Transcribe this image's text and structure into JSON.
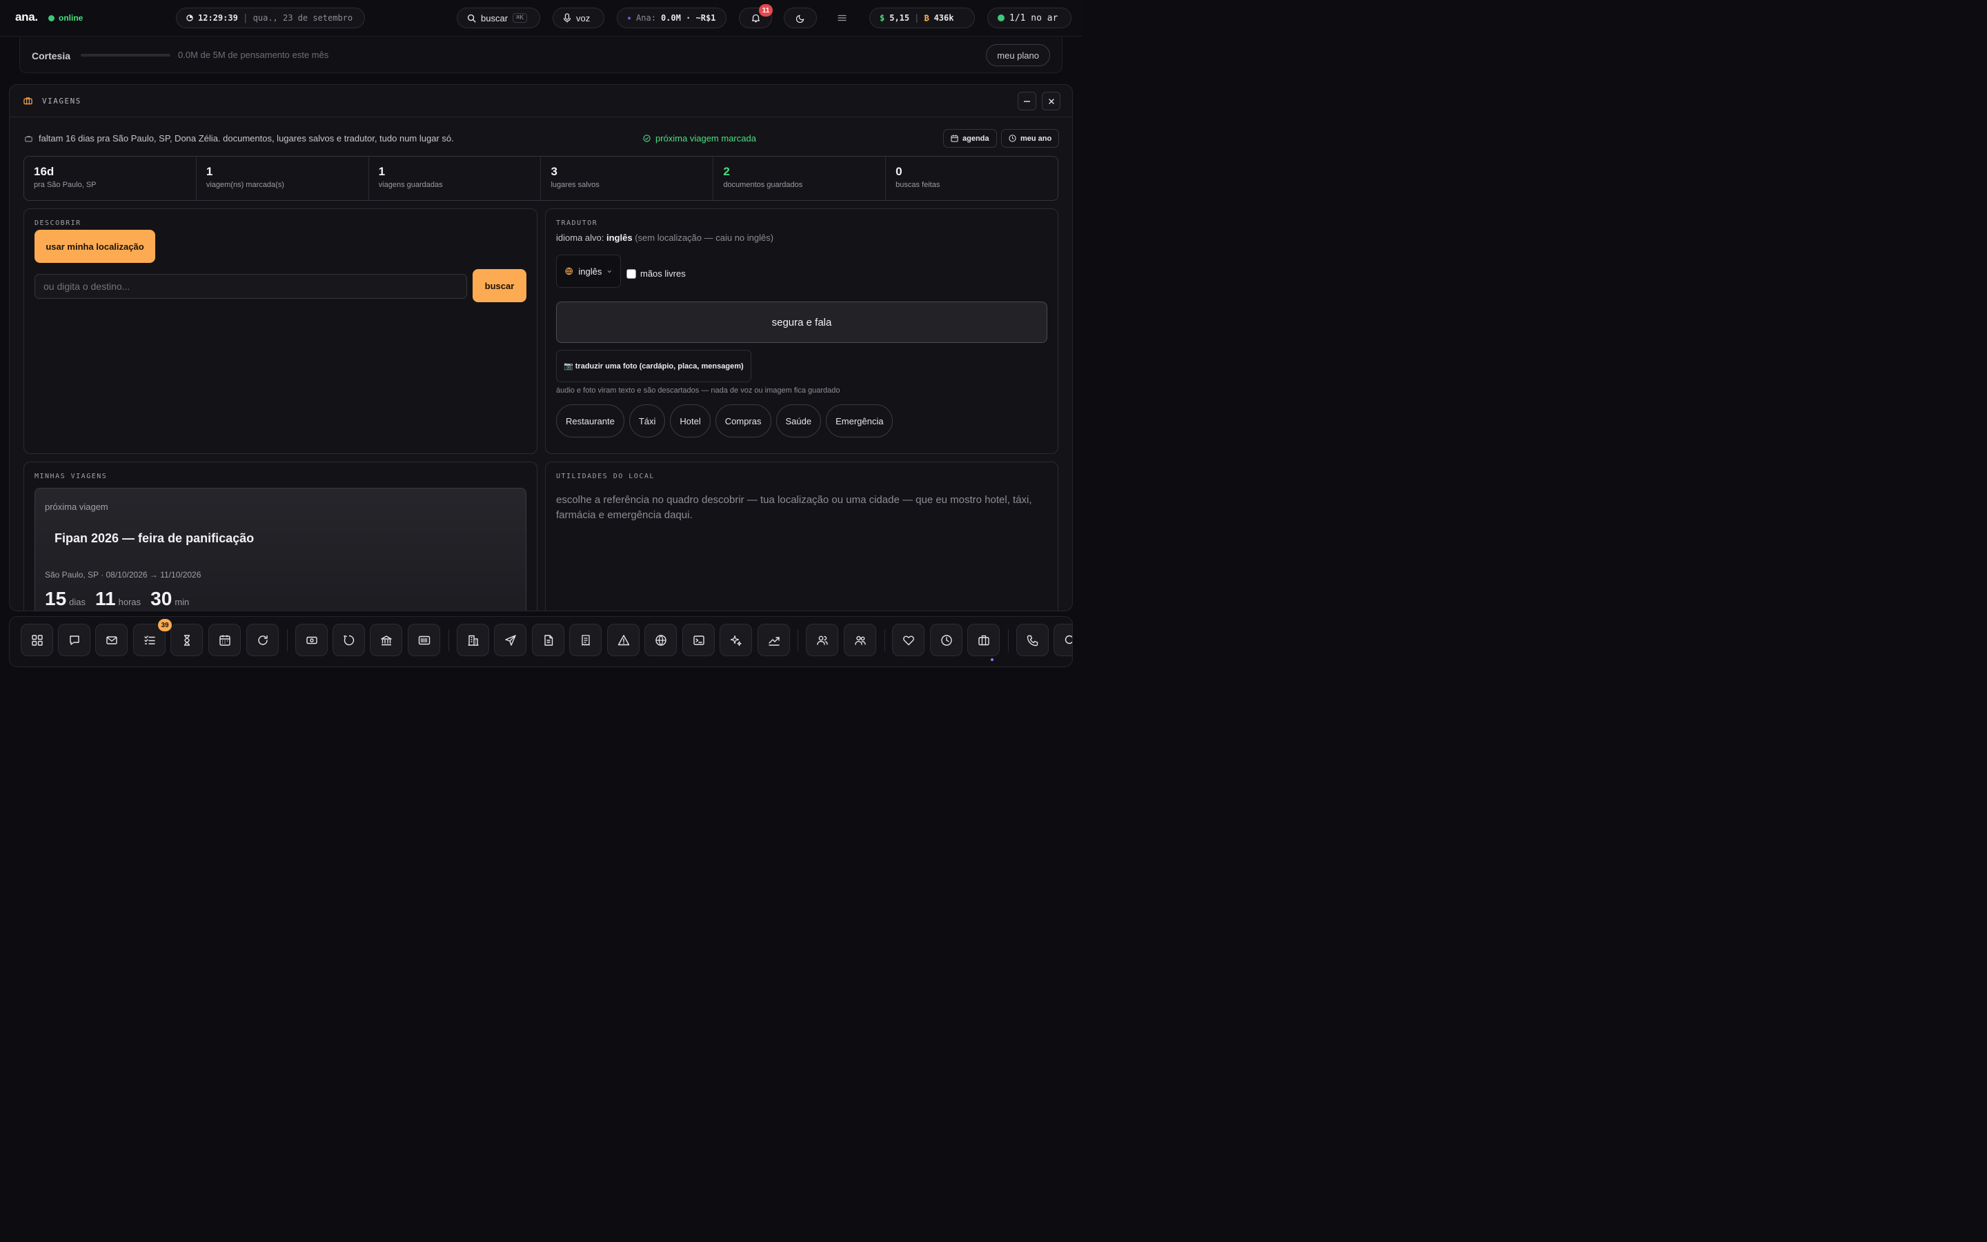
{
  "topbar": {
    "logo": "ana.",
    "status": "online",
    "time": "12:29:39",
    "date": "qua., 23 de setembro",
    "search_label": "buscar",
    "search_kbd": "⌘K",
    "voice_label": "voz",
    "ana_label": "Ana:",
    "ana_usage": "0.0M · ~R$1",
    "notifications_count": "11",
    "dollar_value": "5,15",
    "bitcoin_value": "436k",
    "on_air": "1/1 no ar"
  },
  "plan": {
    "name": "Cortesia",
    "usage_text": "0.0M de 5M de pensamento este mês",
    "usage_fraction": 0.0,
    "button": "meu plano"
  },
  "panel": {
    "title": "VIAGENS",
    "intro": "faltam 16 dias pra São Paulo, SP, Dona Zélia. documentos, lugares salvos e tradutor, tudo num lugar só.",
    "next_trip_status": "próxima viagem marcada",
    "agenda_button": "agenda",
    "year_button": "meu ano"
  },
  "stats": [
    {
      "value": "16d",
      "label": "pra São Paulo, SP"
    },
    {
      "value": "1",
      "label": "viagem(ns) marcada(s)"
    },
    {
      "value": "1",
      "label": "viagens guardadas"
    },
    {
      "value": "3",
      "label": "lugares salvos"
    },
    {
      "value": "2",
      "label": "documentos guardados"
    },
    {
      "value": "0",
      "label": "buscas feitas"
    }
  ],
  "discover": {
    "title": "DESCOBRIR",
    "location_button": "usar minha localização",
    "destination_placeholder": "ou digita o destino...",
    "search_button": "buscar"
  },
  "translator": {
    "title": "TRADUTOR",
    "target_prefix": "idioma alvo:",
    "target_lang": "inglês",
    "target_note": "(sem localização — caiu no inglês)",
    "selected_lang": "inglês",
    "hands_free": "mãos livres",
    "talk_button": "segura e fala",
    "photo_button": "📷 traduzir uma foto (cardápio, placa, mensagem)",
    "privacy_note": "áudio e foto viram texto e são descartados — nada de voz ou imagem fica guardado",
    "chips": [
      "Restaurante",
      "Táxi",
      "Hotel",
      "Compras",
      "Saúde",
      "Emergência"
    ]
  },
  "my_trips": {
    "title": "MINHAS VIAGENS",
    "kicker": "próxima viagem",
    "name": "Fipan 2026 — feira de panificação",
    "meta": "São Paulo, SP · 08/10/2026 → 11/10/2026",
    "days": "15",
    "days_unit": "dias",
    "hours": "11",
    "hours_unit": "horas",
    "minutes": "30",
    "minutes_unit": "min"
  },
  "utilities": {
    "title": "UTILIDADES DO LOCAL",
    "text": "escolhe a referência no quadro descobrir — tua localização ou uma cidade — que eu mostro hotel, táxi, farmácia e emergência daqui."
  },
  "dock": {
    "tasks_badge": "39"
  },
  "colors": {
    "accent": "#fdab52",
    "success": "#4ade80",
    "danger": "#e5484d",
    "background": "#0d0d11"
  }
}
